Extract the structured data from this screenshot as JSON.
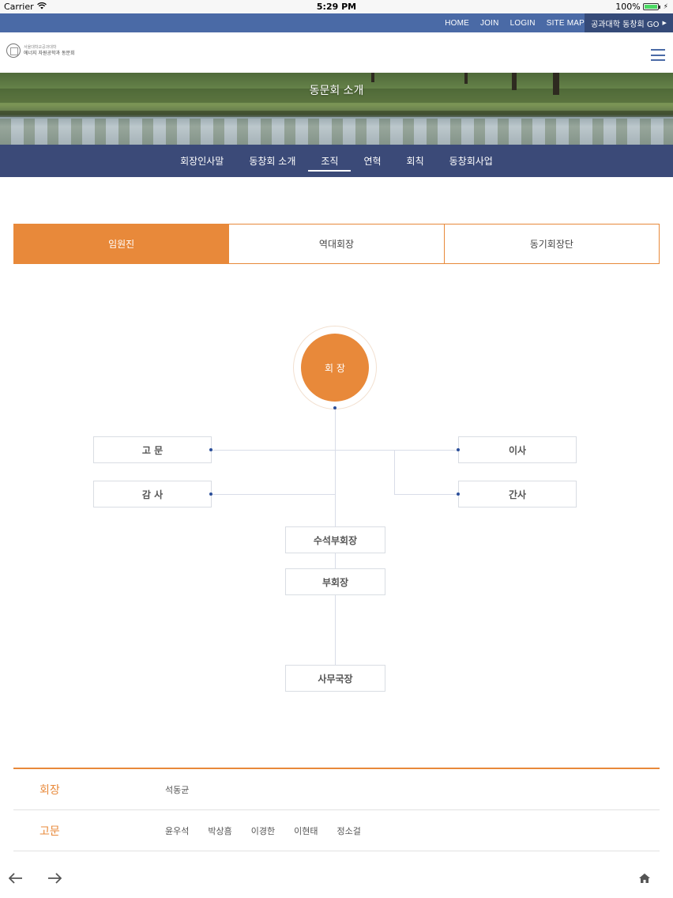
{
  "status_bar": {
    "carrier": "Carrier",
    "time": "5:29 PM",
    "battery": "100%"
  },
  "top_nav": {
    "links": [
      "HOME",
      "JOIN",
      "LOGIN",
      "SITE MAP"
    ],
    "go_label": "공과대학 동창회 GO"
  },
  "header": {
    "logo_line1": "서울대학교공과대학",
    "logo_line2": "에너지 자원공학과 동문회"
  },
  "banner": {
    "title": "동문회 소개"
  },
  "sub_nav": {
    "items": [
      "회장인사말",
      "동창회 소개",
      "조직",
      "연혁",
      "회칙",
      "동창회사업"
    ],
    "active_index": 2
  },
  "tabs": {
    "items": [
      "임원진",
      "역대회장",
      "동기회장단"
    ],
    "active_index": 0
  },
  "org_chart": {
    "president": "회 장",
    "advisor": "고 문",
    "auditor": "감 사",
    "director": "이사",
    "secretary": "간사",
    "senior_vp": "수석부회장",
    "vice_president": "부회장",
    "secretary_general": "사무국장"
  },
  "roster": [
    {
      "role": "회장",
      "names": [
        "석동균"
      ]
    },
    {
      "role": "고문",
      "names": [
        "윤우석",
        "박상흠",
        "이경한",
        "이현태",
        "정소걸"
      ]
    }
  ],
  "colors": {
    "accent": "#e8893a",
    "nav_blue": "#4a6aa6",
    "subnav_blue": "#3b4a78"
  },
  "icons": {
    "back": "arrow-left-icon",
    "forward": "arrow-right-icon",
    "home": "home-icon"
  }
}
